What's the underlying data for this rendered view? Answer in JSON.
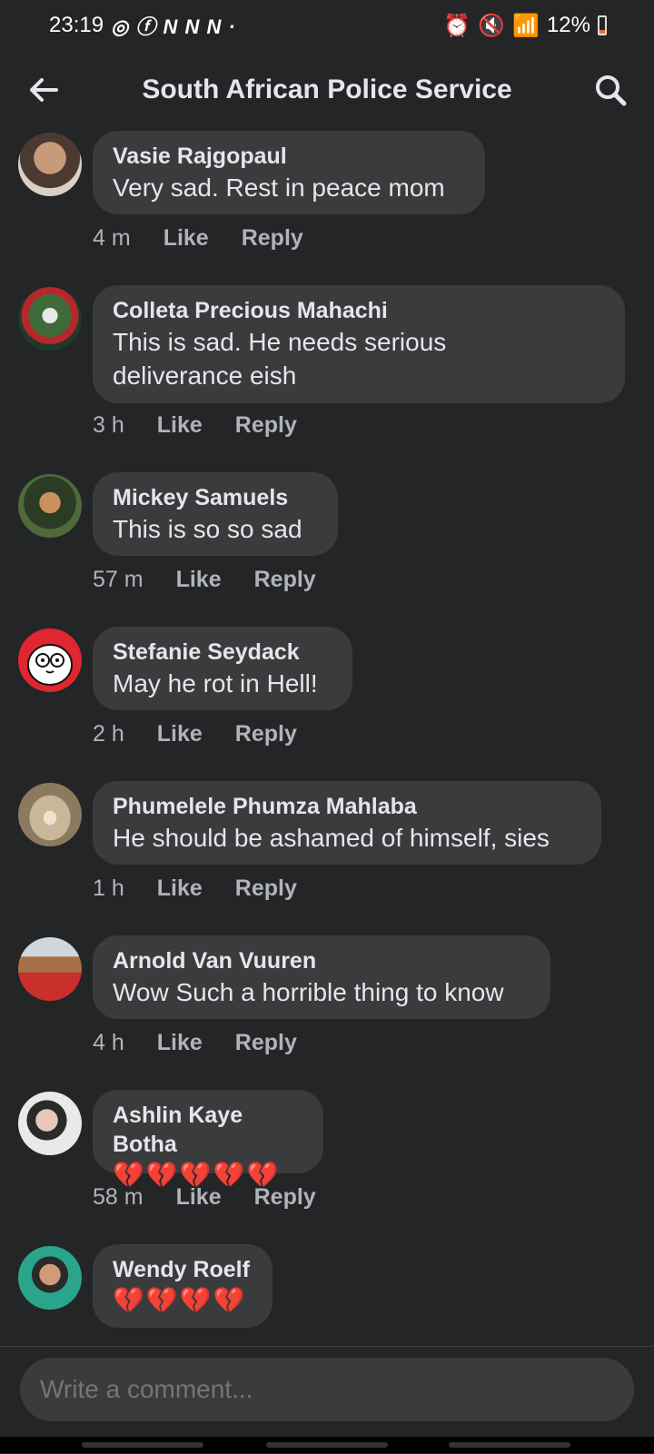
{
  "status": {
    "time": "23:19",
    "battery": "12%"
  },
  "header": {
    "title": "South African Police Service"
  },
  "comments": [
    {
      "name": "Vasie Rajgopaul",
      "lines": [
        "Very sad. Rest in peace mom"
      ],
      "time": "4 m",
      "like": "Like",
      "reply": "Reply"
    },
    {
      "name": "Colleta Precious Mahachi",
      "lines": [
        "This is sad. He needs serious",
        "deliverance eish"
      ],
      "time": "3 h",
      "like": "Like",
      "reply": "Reply"
    },
    {
      "name": "Mickey Samuels",
      "lines": [
        "This is so so sad"
      ],
      "time": "57 m",
      "like": "Like",
      "reply": "Reply"
    },
    {
      "name": "Stefanie Seydack",
      "lines": [
        "May he rot in Hell!"
      ],
      "time": "2 h",
      "like": "Like",
      "reply": "Reply"
    },
    {
      "name": "Phumelele Phumza Mahlaba",
      "lines": [
        "He should be ashamed of himself, sies"
      ],
      "time": "1 h",
      "like": "Like",
      "reply": "Reply"
    },
    {
      "name": "Arnold Van Vuuren",
      "lines": [
        "Wow Such a horrible thing to know"
      ],
      "time": "4 h",
      "like": "Like",
      "reply": "Reply"
    },
    {
      "name": "Ashlin Kaye Botha",
      "lines": [
        "💔💔💔💔💔"
      ],
      "time": "58 m",
      "like": "Like",
      "reply": "Reply"
    },
    {
      "name": "Wendy Roelf",
      "lines": [
        "💔💔💔💔"
      ]
    }
  ],
  "composer": {
    "placeholder": "Write a comment..."
  }
}
